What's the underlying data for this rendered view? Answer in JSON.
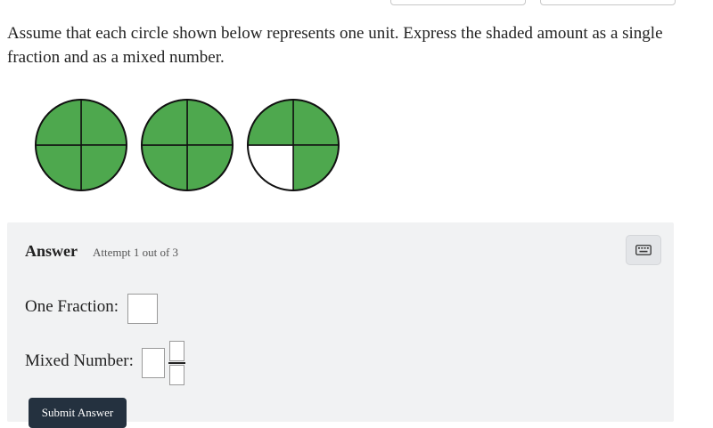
{
  "question": {
    "text": "Assume that each circle shown below represents one unit. Express the shaded amount as a single fraction and as a mixed number."
  },
  "figure": {
    "shaded_color": "#4ea84e",
    "unshaded_color": "#ffffff",
    "circles": [
      {
        "parts": 4,
        "shaded": [
          true,
          true,
          true,
          true
        ]
      },
      {
        "parts": 4,
        "shaded": [
          true,
          true,
          true,
          true
        ]
      },
      {
        "parts": 4,
        "shaded": [
          true,
          true,
          false,
          true
        ]
      }
    ]
  },
  "answer": {
    "title": "Answer",
    "attempt": "Attempt 1 out of 3",
    "keyboard_icon": "keyboard-icon",
    "one_fraction_label": "One Fraction:",
    "mixed_number_label": "Mixed Number:",
    "submit_label": "Submit Answer"
  }
}
